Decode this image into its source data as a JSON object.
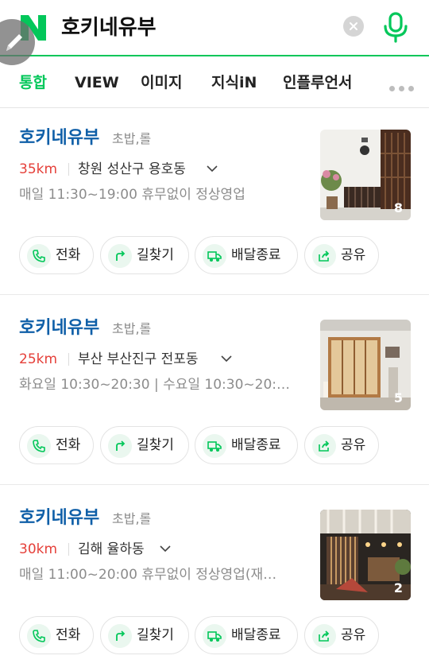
{
  "search": {
    "query": "호키네유부",
    "logo": "N",
    "icons": [
      "naver-logo",
      "clear-icon",
      "mic-icon",
      "edit-icon"
    ]
  },
  "tabs": [
    {
      "label": "통합",
      "active": true
    },
    {
      "label": "VIEW",
      "active": false
    },
    {
      "label": "이미지",
      "active": false
    },
    {
      "label": "지식iN",
      "active": false
    },
    {
      "label": "인플루언서",
      "active": false
    }
  ],
  "actions": {
    "call": "전화",
    "directions": "길찾기",
    "delivery": "배달종료",
    "share": "공유"
  },
  "results": [
    {
      "name": "호키네유부",
      "category": "초밥,롤",
      "distance": "35km",
      "address": "창원 성산구 용호동",
      "hours": "매일 11:30~19:00 휴무없이 정상영업",
      "photo_count": "8"
    },
    {
      "name": "호키네유부",
      "category": "초밥,롤",
      "distance": "25km",
      "address": "부산 부산진구 전포동",
      "hours": "화요일 10:30~20:30 | 수요일 10:30~20:…",
      "photo_count": "5"
    },
    {
      "name": "호키네유부",
      "category": "초밥,롤",
      "distance": "30km",
      "address": "김해 율하동",
      "hours": "매일 11:00~20:00 휴무없이 정상영업(재…",
      "photo_count": "2"
    }
  ],
  "colors": {
    "brand_green": "#03c75a",
    "title_blue": "#0f5fa8",
    "distance_red": "#e5403a"
  }
}
